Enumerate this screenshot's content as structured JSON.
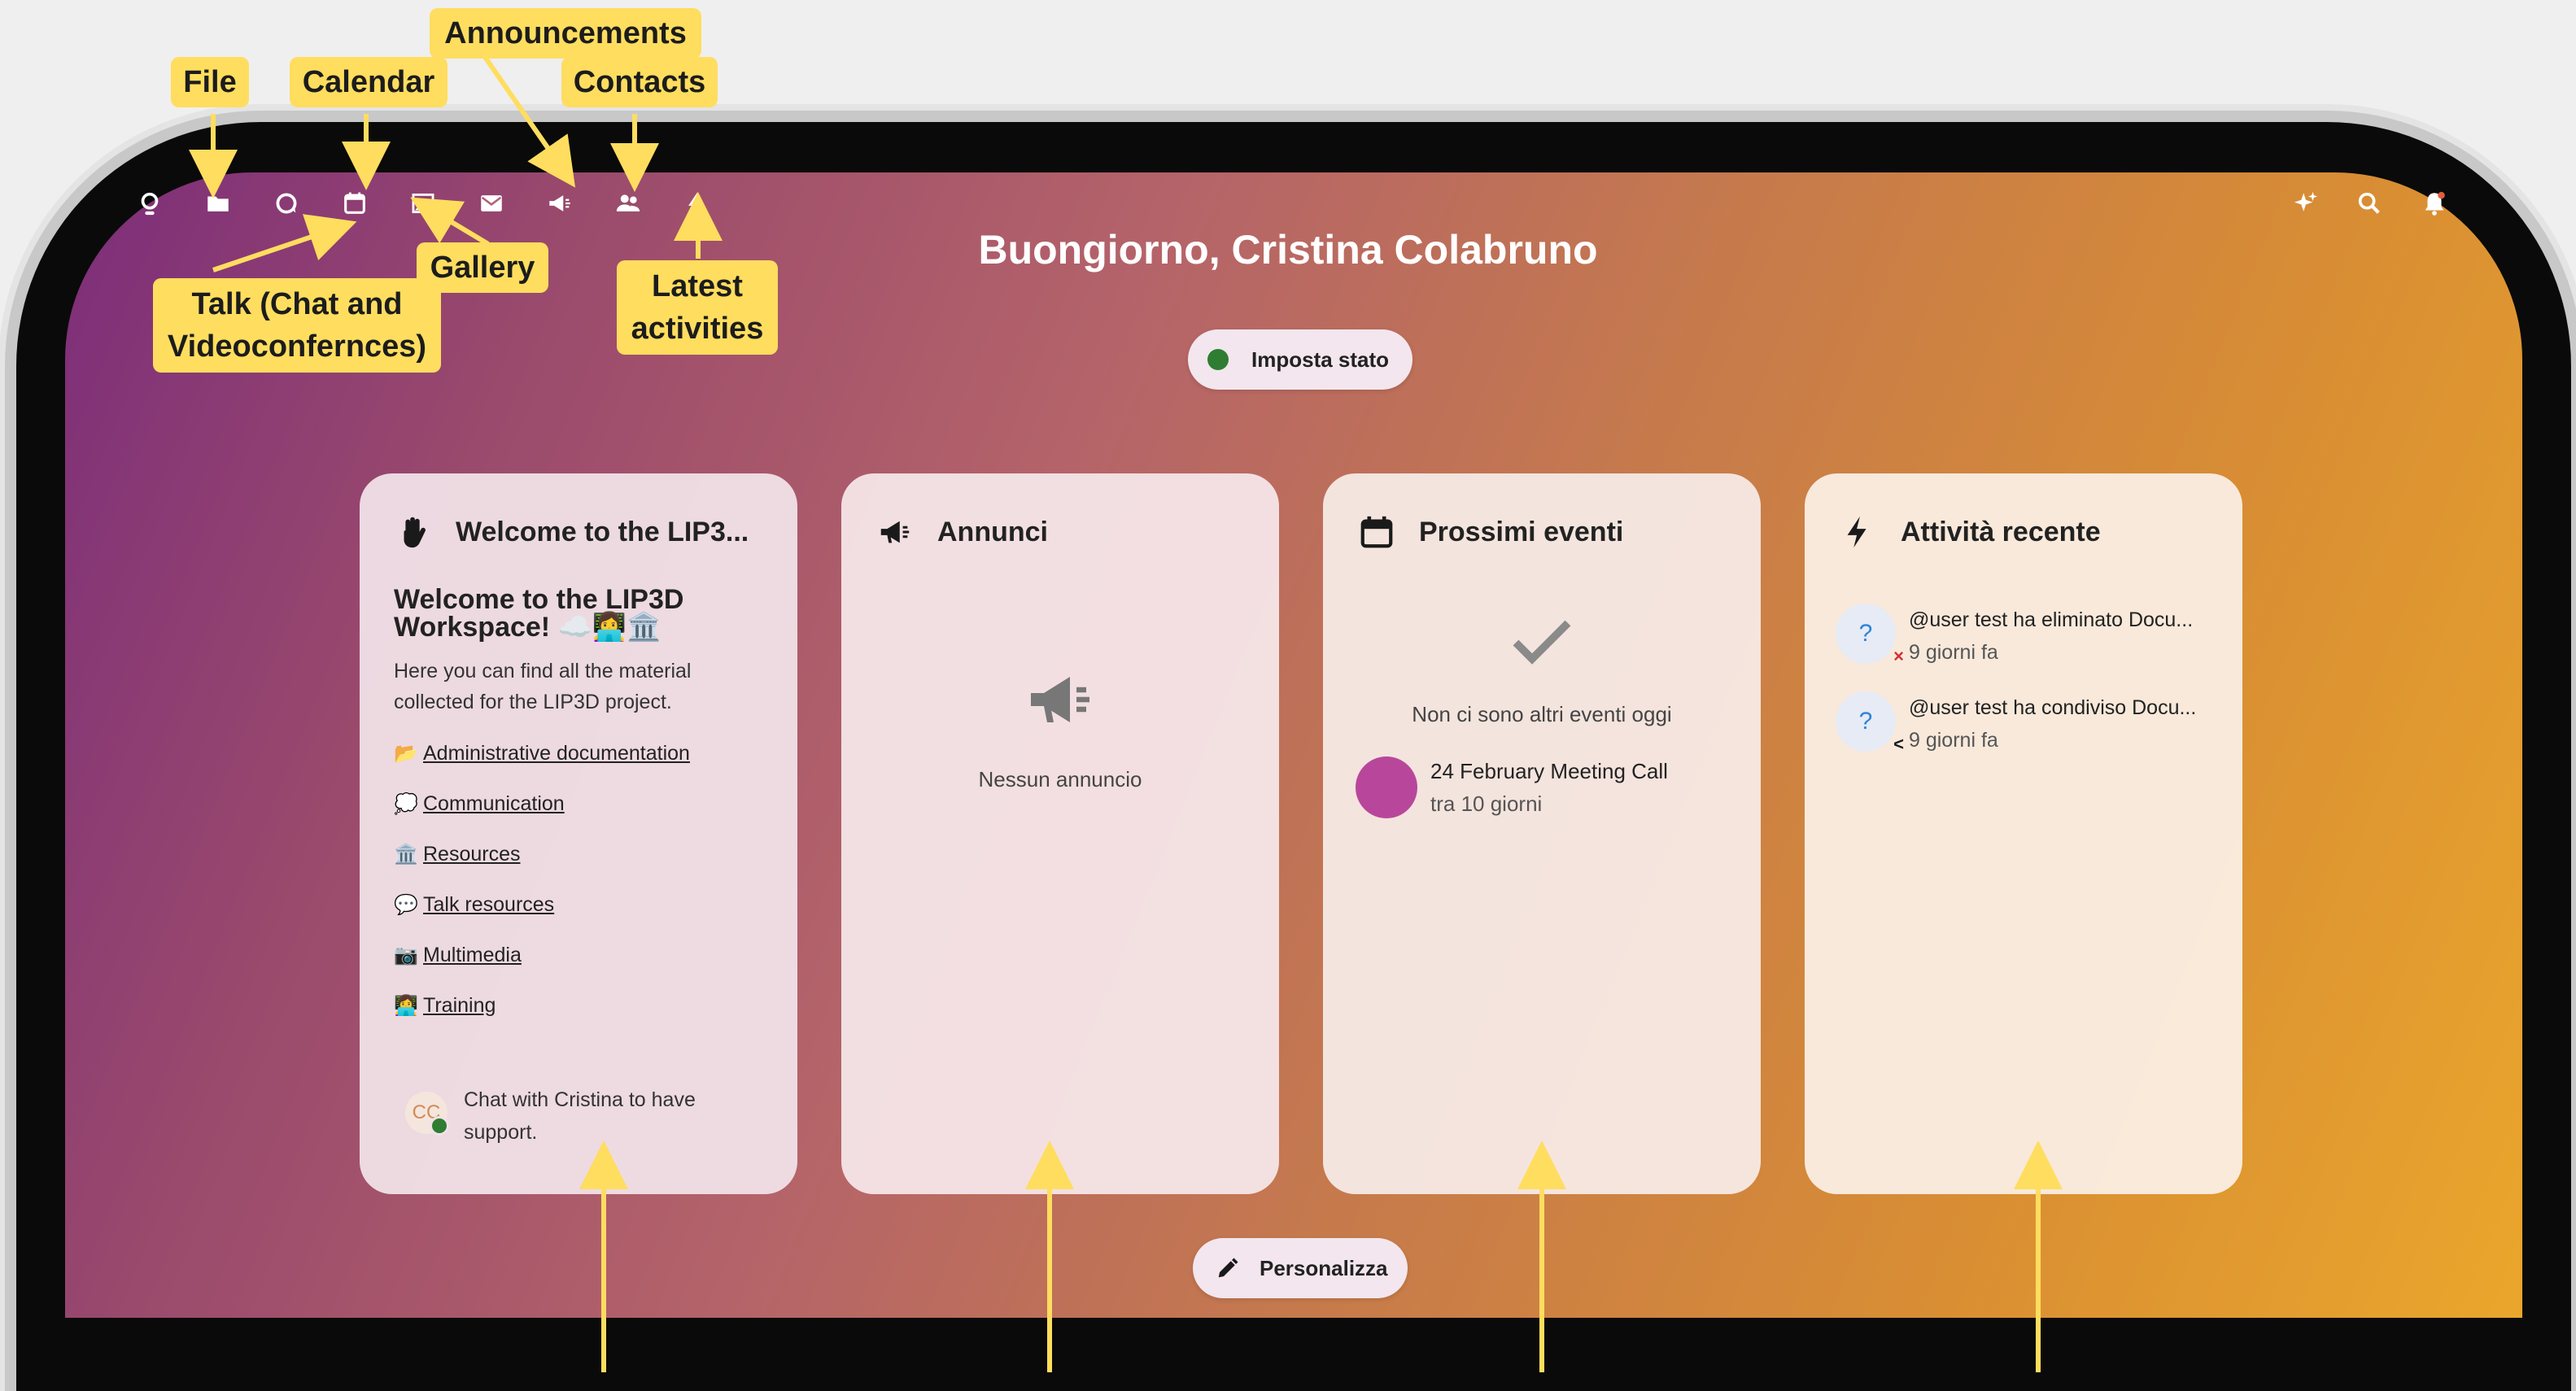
{
  "colors": {
    "accent_yellow": "#ffdd5f",
    "status_green": "#2e7d32",
    "event_color": "#b8479b"
  },
  "nav": {
    "icons": [
      "logo-icon",
      "folder-icon",
      "talk-icon",
      "calendar-icon",
      "gallery-icon",
      "mail-icon",
      "megaphone-icon",
      "contacts-icon",
      "activity-icon"
    ],
    "right_icons": [
      "sparkle-icon",
      "search-icon",
      "bell-icon"
    ]
  },
  "greeting": "Buongiorno, Cristina Colabruno",
  "status_button": "Imposta stato",
  "customize_button": "Personalizza",
  "welcome_widget": {
    "title": "Welcome to the LIP3...",
    "heading": "Welcome to the LIP3D Workspace! ☁️👩‍💻🏛️",
    "intro": "Here you can find all the material collected for the LIP3D project.",
    "links": [
      {
        "emoji": "📂",
        "label": "Administrative documentation"
      },
      {
        "emoji": "💭",
        "label": "Communication"
      },
      {
        "emoji": "🏛️",
        "label": "Resources"
      },
      {
        "emoji": "💬",
        "label": "Talk resources"
      },
      {
        "emoji": "📷",
        "label": "Multimedia"
      },
      {
        "emoji": "👩‍💻",
        "label": "Training"
      }
    ],
    "support_initials": "CC",
    "support_text": "Chat with Cristina to have support."
  },
  "announcements_widget": {
    "title": "Annunci",
    "empty": "Nessun annuncio"
  },
  "events_widget": {
    "title": "Prossimi eventi",
    "empty": "Non ci sono altri eventi oggi",
    "event": {
      "name": "24 February Meeting Call",
      "when": "tra 10 giorni"
    }
  },
  "activity_widget": {
    "title": "Attività recente",
    "items": [
      {
        "avatar": "?",
        "text": "@user test ha eliminato Docu...",
        "time": "9 giorni fa",
        "badge": "×"
      },
      {
        "avatar": "?",
        "text": "@user test ha condiviso Docu...",
        "time": "9 giorni fa",
        "badge": "<"
      }
    ]
  },
  "annotations": {
    "file": "File",
    "calendar": "Calendar",
    "announcements": "Announcements",
    "contacts": "Contacts",
    "gallery": "Gallery",
    "talk_line1": "Talk (Chat and",
    "talk_line2": "Videoconfernces)",
    "latest_line1": "Latest",
    "latest_line2": "activities"
  }
}
